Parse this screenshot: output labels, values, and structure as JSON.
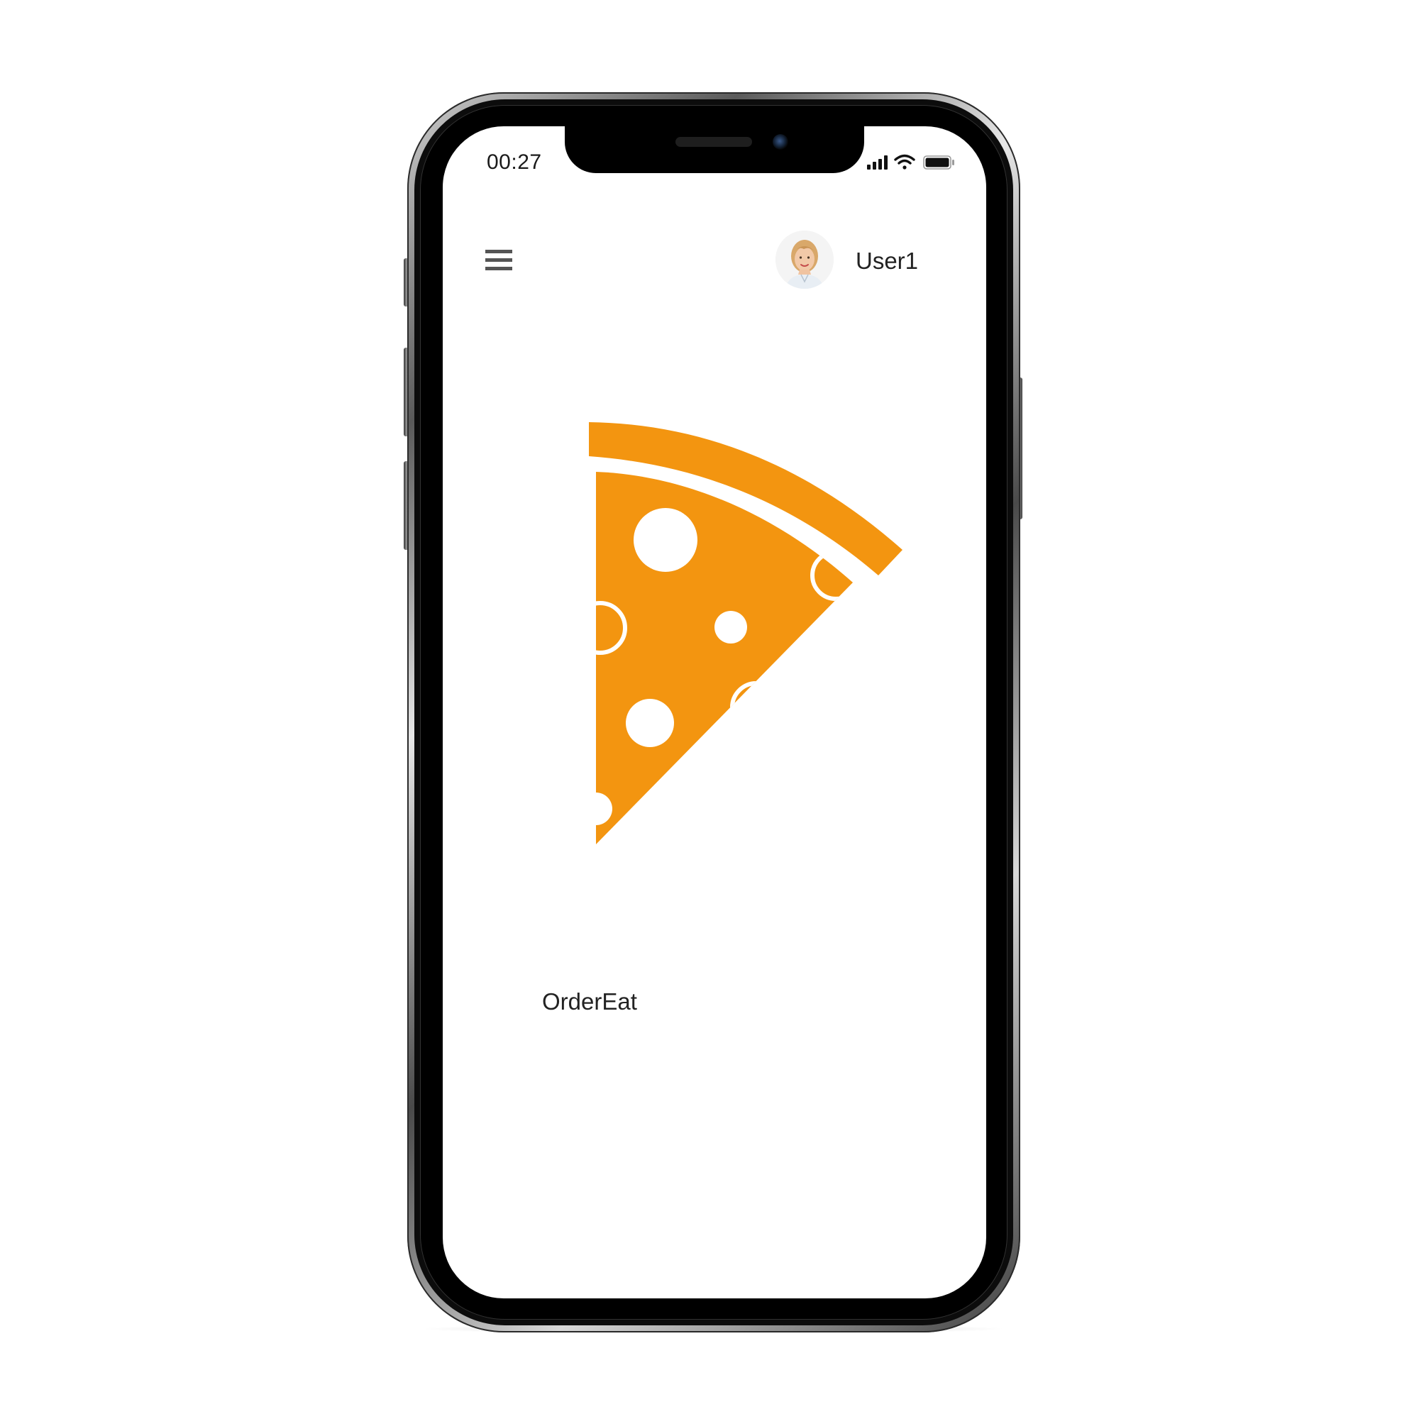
{
  "status_bar": {
    "time": "00:27",
    "icons": [
      "signal-icon",
      "wifi-icon",
      "battery-icon"
    ]
  },
  "header": {
    "menu_icon": "hamburger-menu-icon",
    "avatar_icon": "user-avatar",
    "username": "User1"
  },
  "main": {
    "logo_icon": "pizza-slice-icon",
    "brand_name": "OrderEat"
  },
  "colors": {
    "accent": "#F39510",
    "text": "#222222",
    "background": "#FFFFFF"
  }
}
